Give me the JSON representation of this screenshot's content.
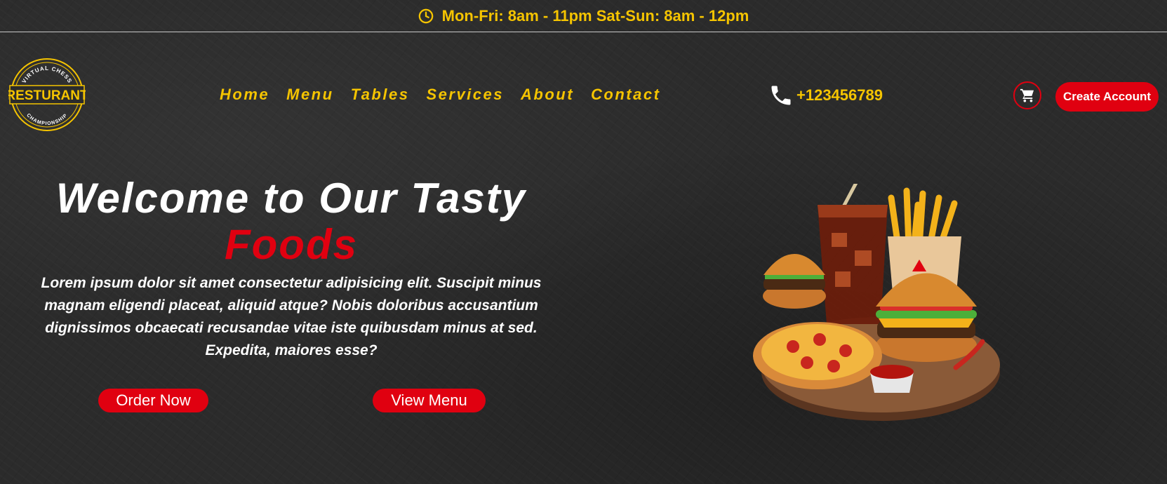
{
  "topbar": {
    "hours": "Mon-Fri: 8am - 11pm Sat-Sun: 8am - 12pm",
    "icon": "clock-icon"
  },
  "logo": {
    "top_text": "VIRTUAL CHESS",
    "main_text": "RESTURANT",
    "bottom_text": "CHAMPIONSHIP"
  },
  "nav": {
    "items": [
      "Home",
      "Menu",
      "Tables",
      "Services",
      "About",
      "Contact"
    ]
  },
  "phone": {
    "icon": "phone-icon",
    "number": "+123456789"
  },
  "cart": {
    "icon": "cart-icon"
  },
  "account": {
    "label": "Create Account"
  },
  "hero": {
    "title": "Welcome to Our Tasty",
    "title_accent": "Foods",
    "description": "Lorem ipsum dolor sit amet consectetur adipisicing elit. Suscipit minus magnam eligendi placeat, aliquid atque? Nobis doloribus accusantium dignissimos obcaecati recusandae vitae iste quibusdam minus at sed. Expedita, maiores esse?",
    "order_label": "Order Now",
    "menu_label": "View Menu"
  },
  "colors": {
    "accent": "#e00010",
    "gold": "#f5c400",
    "background": "#2b2b2b"
  }
}
